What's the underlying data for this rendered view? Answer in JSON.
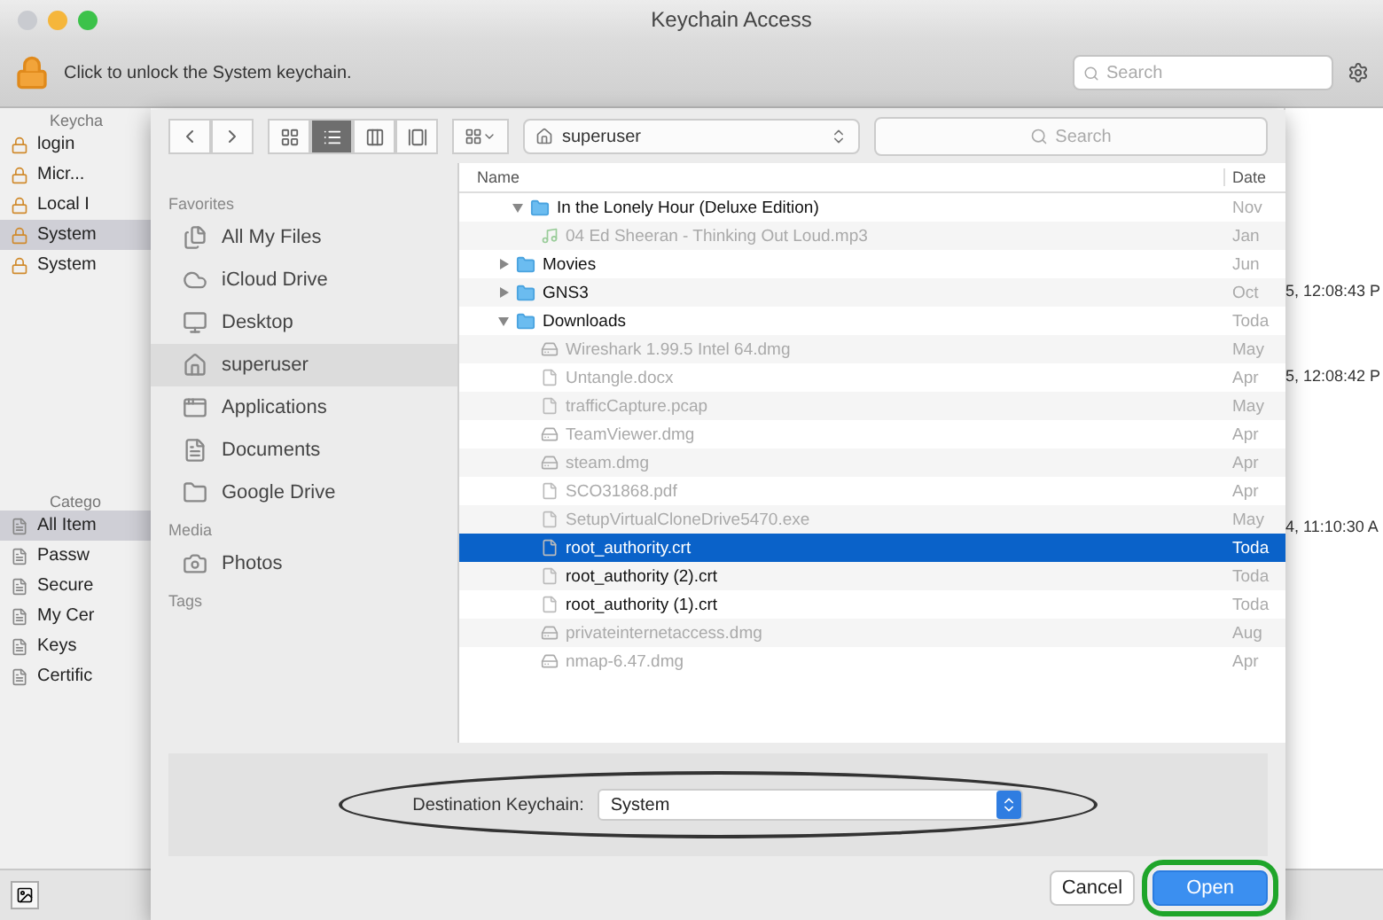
{
  "window": {
    "title": "Keychain Access"
  },
  "toolbar": {
    "lock_message": "Click to unlock the System keychain.",
    "search": {
      "placeholder": "Search"
    }
  },
  "keychains": {
    "header": "Keycha",
    "items": [
      {
        "label": "login",
        "selected": false
      },
      {
        "label": "Micr...",
        "selected": false
      },
      {
        "label": "Local I",
        "selected": false
      },
      {
        "label": "System",
        "selected": true
      },
      {
        "label": "System",
        "selected": false
      }
    ]
  },
  "categories": {
    "header": "Catego",
    "items": [
      {
        "label": "All Item",
        "selected": true
      },
      {
        "label": "Passw",
        "selected": false
      },
      {
        "label": "Secure",
        "selected": false
      },
      {
        "label": "My Cer",
        "selected": false
      },
      {
        "label": "Keys",
        "selected": false
      },
      {
        "label": "Certific",
        "selected": false
      }
    ]
  },
  "list_tail": [
    "5, 12:08:43 P",
    "5, 12:08:42 P",
    "4, 11:10:30 A"
  ],
  "dialog": {
    "view_modes": [
      {
        "selected": false
      },
      {
        "selected": true
      },
      {
        "selected": false
      },
      {
        "selected": false
      }
    ],
    "location": "superuser",
    "search": {
      "placeholder": "Search"
    },
    "sidebar": [
      {
        "header": "Favorites",
        "items": [
          {
            "label": "All My Files",
            "kind": "files",
            "selected": false
          },
          {
            "label": "iCloud Drive",
            "kind": "cloud",
            "selected": false
          },
          {
            "label": "Desktop",
            "kind": "desktop",
            "selected": false
          },
          {
            "label": "superuser",
            "kind": "home",
            "selected": true
          },
          {
            "label": "Applications",
            "kind": "apps",
            "selected": false
          },
          {
            "label": "Documents",
            "kind": "docs",
            "selected": false
          },
          {
            "label": "Google Drive",
            "kind": "folder",
            "selected": false
          }
        ]
      },
      {
        "header": "Media",
        "items": [
          {
            "label": "Photos",
            "kind": "photos",
            "selected": false
          }
        ]
      },
      {
        "header": "Tags"
      }
    ],
    "columns": [
      "Name",
      "Date"
    ],
    "rows": [
      {
        "name": "In the Lonely Hour (Deluxe Edition)",
        "date": "Nov",
        "kind": "folder",
        "expanded": true,
        "enabled": true,
        "selected": false,
        "children": [
          {
            "name": "04 Ed Sheeran - Thinking Out Loud.mp3",
            "date": "Jan",
            "kind": "audio",
            "enabled": false,
            "selected": false
          }
        ]
      },
      {
        "name": "Movies",
        "date": "Jun",
        "kind": "folder",
        "expanded": false,
        "enabled": true,
        "selected": false
      },
      {
        "name": "GNS3",
        "date": "Oct",
        "kind": "folder",
        "expanded": false,
        "enabled": true,
        "selected": false
      },
      {
        "name": "Downloads",
        "date": "Toda",
        "kind": "folder",
        "expanded": true,
        "enabled": true,
        "selected": false,
        "children": [
          {
            "name": "Wireshark 1.99.5 Intel 64.dmg",
            "date": "May",
            "kind": "disk",
            "enabled": false,
            "selected": false
          },
          {
            "name": "Untangle.docx",
            "date": "Apr",
            "kind": "file",
            "enabled": false,
            "selected": false
          },
          {
            "name": "trafficCapture.pcap",
            "date": "May",
            "kind": "file",
            "enabled": false,
            "selected": false
          },
          {
            "name": "TeamViewer.dmg",
            "date": "Apr",
            "kind": "disk",
            "enabled": false,
            "selected": false
          },
          {
            "name": "steam.dmg",
            "date": "Apr",
            "kind": "disk",
            "enabled": false,
            "selected": false
          },
          {
            "name": "SCO31868.pdf",
            "date": "Apr",
            "kind": "file",
            "enabled": false,
            "selected": false
          },
          {
            "name": "SetupVirtualCloneDrive5470.exe",
            "date": "May",
            "kind": "file",
            "enabled": false,
            "selected": false
          },
          {
            "name": "root_authority.crt",
            "date": "Toda",
            "kind": "file",
            "enabled": true,
            "selected": true
          },
          {
            "name": "root_authority (2).crt",
            "date": "Toda",
            "kind": "file",
            "enabled": true,
            "selected": false
          },
          {
            "name": "root_authority (1).crt",
            "date": "Toda",
            "kind": "file",
            "enabled": true,
            "selected": false
          },
          {
            "name": "privateinternetaccess.dmg",
            "date": "Aug",
            "kind": "disk",
            "enabled": false,
            "selected": false
          },
          {
            "name": "nmap-6.47.dmg",
            "date": "Apr",
            "kind": "disk",
            "enabled": false,
            "selected": false
          }
        ]
      }
    ],
    "destination": {
      "label": "Destination Keychain:",
      "value": "System"
    },
    "buttons": [
      {
        "label": "Cancel",
        "kind": "cancel"
      },
      {
        "label": "Open",
        "kind": "default"
      }
    ]
  }
}
